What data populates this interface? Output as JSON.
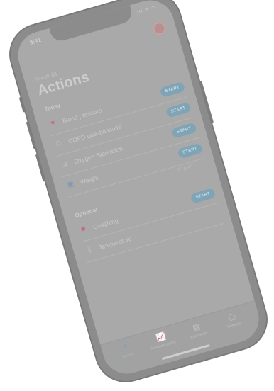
{
  "status": {
    "time": "9:41",
    "icons": "ııl ≋ ▭"
  },
  "header": {
    "small_title": "Week 01",
    "title": "Actions"
  },
  "sections": {
    "today": "Today",
    "optional": "Optional"
  },
  "today_items": [
    {
      "label": "Blood pressure",
      "action": "START",
      "icon": "heart-icon",
      "icon_glyph": "♥",
      "icon_color": "#c26d86"
    },
    {
      "label": "COPD questionnaire",
      "action": "START",
      "icon": "lungs-icon",
      "icon_glyph": "✿",
      "icon_color": "#b7b7b7"
    },
    {
      "label": "Oxygen Saturation",
      "action": "START",
      "icon": "chart-icon",
      "icon_glyph": "◢",
      "icon_color": "#b7b7b7"
    },
    {
      "label": "Weight",
      "action": "START",
      "icon": "scale-icon",
      "icon_glyph": "▣",
      "icon_color": "#7e98b3"
    }
  ],
  "optional_items": [
    {
      "label": "Coughing",
      "action": "START",
      "icon": "virus-icon",
      "icon_glyph": "✹",
      "icon_color": "#c06a8c"
    },
    {
      "label": "Temperature",
      "action": "",
      "icon": "thermometer-icon",
      "icon_glyph": "🌡",
      "icon_color": "#b9b9b9"
    }
  ],
  "extra_link": "START",
  "tabs": [
    {
      "label": "Actions",
      "icon": "heart-tab-icon",
      "glyph": "♥",
      "active": true
    },
    {
      "label": "Measurements",
      "icon": "chart-tab-icon",
      "glyph": "📈",
      "active": false
    },
    {
      "label": "Education",
      "icon": "book-tab-icon",
      "glyph": "▤",
      "active": false
    },
    {
      "label": "Settings",
      "icon": "doc-tab-icon",
      "glyph": "▢",
      "active": false
    }
  ],
  "colors": {
    "accent": "#7ea4b6",
    "screen": "#a9a9a9",
    "frame": "#8c8c8c"
  }
}
